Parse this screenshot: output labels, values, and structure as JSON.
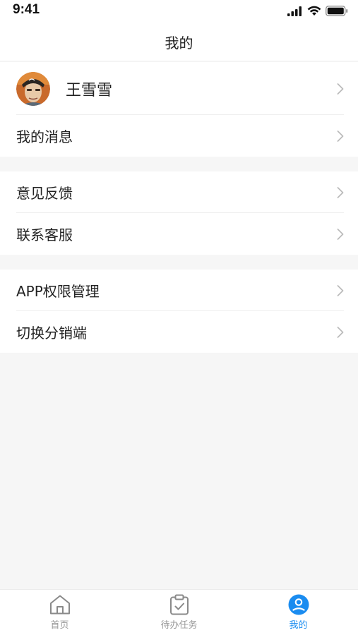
{
  "status_bar": {
    "time": "9:41"
  },
  "header": {
    "title": "我的"
  },
  "profile": {
    "name": "王雪雪"
  },
  "groups": [
    {
      "items": [
        {
          "label": "我的消息"
        }
      ]
    },
    {
      "items": [
        {
          "label": "意见反馈"
        },
        {
          "label": "联系客服"
        }
      ]
    },
    {
      "items": [
        {
          "label": "APP权限管理"
        },
        {
          "label": "切换分销端"
        }
      ]
    }
  ],
  "tabbar": {
    "tabs": [
      {
        "label": "首页",
        "icon": "home-icon"
      },
      {
        "label": "待办任务",
        "icon": "clipboard-check-icon"
      },
      {
        "label": "我的",
        "icon": "user-icon",
        "active": true
      }
    ],
    "active_color": "#1a8cf0",
    "inactive_color": "#999999"
  }
}
